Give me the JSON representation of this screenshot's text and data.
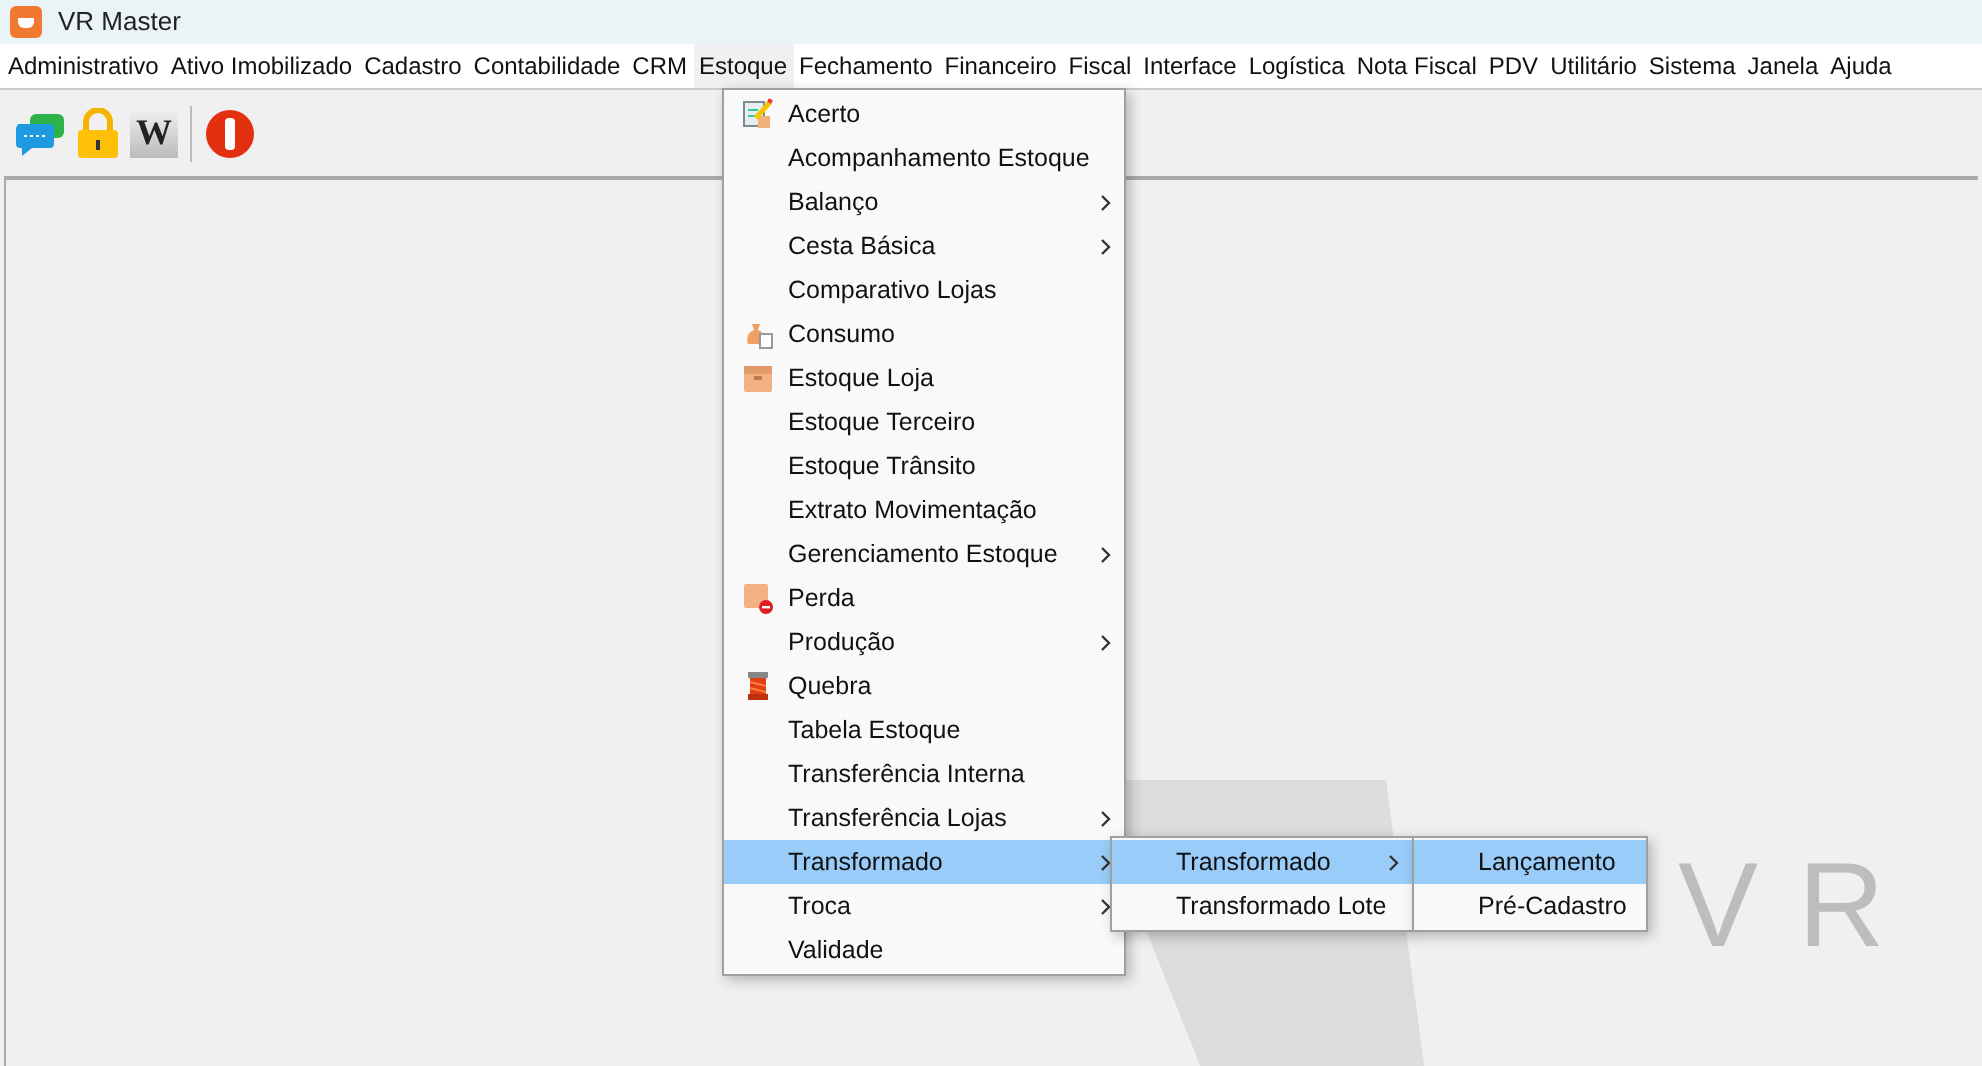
{
  "window": {
    "title": "VR Master"
  },
  "menu_bar": [
    {
      "label": "Administrativo",
      "selected": false
    },
    {
      "label": "Ativo Imobilizado",
      "selected": false
    },
    {
      "label": "Cadastro",
      "selected": false
    },
    {
      "label": "Contabilidade",
      "selected": false
    },
    {
      "label": "CRM",
      "selected": false
    },
    {
      "label": "Estoque",
      "selected": true
    },
    {
      "label": "Fechamento",
      "selected": false
    },
    {
      "label": "Financeiro",
      "selected": false
    },
    {
      "label": "Fiscal",
      "selected": false
    },
    {
      "label": "Interface",
      "selected": false
    },
    {
      "label": "Logística",
      "selected": false
    },
    {
      "label": "Nota Fiscal",
      "selected": false
    },
    {
      "label": "PDV",
      "selected": false
    },
    {
      "label": "Utilitário",
      "selected": false
    },
    {
      "label": "Sistema",
      "selected": false
    },
    {
      "label": "Janela",
      "selected": false
    },
    {
      "label": "Ajuda",
      "selected": false
    }
  ],
  "toolbar": [
    {
      "kind": "chat"
    },
    {
      "kind": "lock"
    },
    {
      "kind": "letter",
      "label": "W"
    },
    {
      "kind": "separator"
    },
    {
      "kind": "stop"
    }
  ],
  "background_logo": "VR",
  "estoque_menu": [
    {
      "label": "Acerto",
      "has_icon": true,
      "submenu": false,
      "selected": false
    },
    {
      "label": "Acompanhamento Estoque",
      "has_icon": false,
      "submenu": false,
      "selected": false
    },
    {
      "label": "Balanço",
      "has_icon": false,
      "submenu": true,
      "selected": false
    },
    {
      "label": "Cesta Básica",
      "has_icon": false,
      "submenu": true,
      "selected": false
    },
    {
      "label": "Comparativo Lojas",
      "has_icon": false,
      "submenu": false,
      "selected": false
    },
    {
      "label": "Consumo",
      "has_icon": true,
      "submenu": false,
      "selected": false
    },
    {
      "label": "Estoque Loja",
      "has_icon": true,
      "submenu": false,
      "selected": false
    },
    {
      "label": "Estoque Terceiro",
      "has_icon": false,
      "submenu": false,
      "selected": false
    },
    {
      "label": "Estoque Trânsito",
      "has_icon": false,
      "submenu": false,
      "selected": false
    },
    {
      "label": "Extrato Movimentação",
      "has_icon": false,
      "submenu": false,
      "selected": false
    },
    {
      "label": "Gerenciamento Estoque",
      "has_icon": false,
      "submenu": true,
      "selected": false
    },
    {
      "label": "Perda",
      "has_icon": true,
      "submenu": false,
      "selected": false
    },
    {
      "label": "Produção",
      "has_icon": false,
      "submenu": true,
      "selected": false
    },
    {
      "label": "Quebra",
      "has_icon": true,
      "submenu": false,
      "selected": false
    },
    {
      "label": "Tabela Estoque",
      "has_icon": false,
      "submenu": false,
      "selected": false
    },
    {
      "label": "Transferência Interna",
      "has_icon": false,
      "submenu": false,
      "selected": false
    },
    {
      "label": "Transferência Lojas",
      "has_icon": false,
      "submenu": true,
      "selected": false
    },
    {
      "label": "Transformado",
      "has_icon": false,
      "submenu": true,
      "selected": true
    },
    {
      "label": "Troca",
      "has_icon": false,
      "submenu": true,
      "selected": false
    },
    {
      "label": "Validade",
      "has_icon": false,
      "submenu": false,
      "selected": false
    }
  ],
  "transformado_menu": [
    {
      "label": "Transformado",
      "submenu": true,
      "selected": true
    },
    {
      "label": "Transformado Lote",
      "submenu": false,
      "selected": false
    }
  ],
  "transformado_submenu": [
    {
      "label": "Lançamento",
      "submenu": false,
      "selected": true
    },
    {
      "label": "Pré-Cadastro",
      "submenu": false,
      "selected": false
    }
  ]
}
